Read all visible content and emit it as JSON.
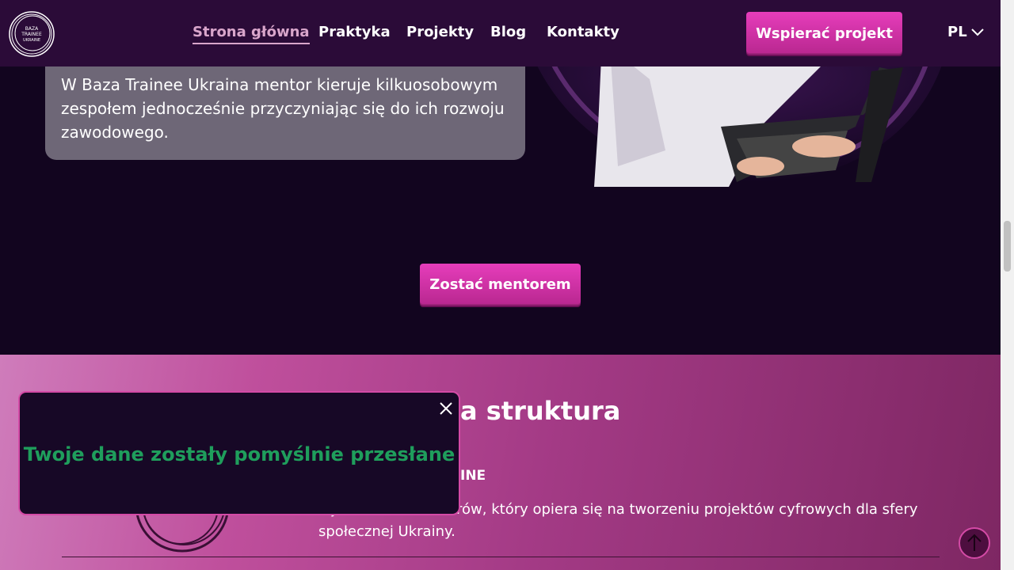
{
  "header": {
    "logo_text": "BAZA TRAINEE UKRAINE",
    "nav": [
      {
        "label": "Strona główna",
        "active": true
      },
      {
        "label": "Praktyka"
      },
      {
        "label": "Projekty"
      },
      {
        "label": "Blog"
      },
      {
        "label": "Kontakty"
      }
    ],
    "support_button": "Wspierać projekt",
    "language": "PL"
  },
  "mentor_section": {
    "text": "W Baza Trainee Ukraina mentor kieruje kilkuosobowym zespołem jednocześnie przyczyniając się do ich rozwoju zawodowego.",
    "button": "Zostać mentorem"
  },
  "structure_section": {
    "title_visible": "a struktura",
    "subtitle_visible": "INE",
    "paragraph_visible": "a juniorów IT i swetrów, który opiera się na tworzeniu projektów cyfrowych dla sfery społecznej Ukrainy."
  },
  "popup": {
    "message": "Twoje dane zostały pomyślnie przesłane"
  },
  "colors": {
    "accent": "#d94aa8",
    "success": "#1f9e5c",
    "header_bg": "#2b0b38",
    "dark_bg": "#12051f"
  }
}
